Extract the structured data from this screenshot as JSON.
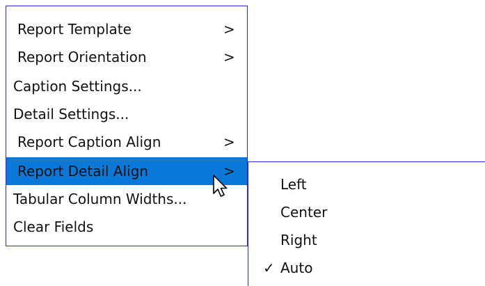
{
  "menu": {
    "items": [
      {
        "label": "Report Template",
        "arrow": ">"
      },
      {
        "label": "Report Orientation",
        "arrow": ">"
      },
      {
        "label": "Caption Settings..."
      },
      {
        "label": "Detail Settings..."
      },
      {
        "label": "Report Caption Align",
        "arrow": ">"
      },
      {
        "label": "Report Detail Align",
        "arrow": ">"
      },
      {
        "label": "Tabular Column Widths..."
      },
      {
        "label": "Clear Fields"
      }
    ]
  },
  "submenu": {
    "items": [
      {
        "label": "Left"
      },
      {
        "label": "Center"
      },
      {
        "label": "Right"
      },
      {
        "label": "Auto",
        "check": "✓"
      }
    ]
  },
  "colors": {
    "menu_border": "#2b2bd6",
    "active_highlight": "#0a78d7"
  },
  "icons": {
    "cursor": "arrow-cursor-icon",
    "check": "checkmark-icon"
  }
}
